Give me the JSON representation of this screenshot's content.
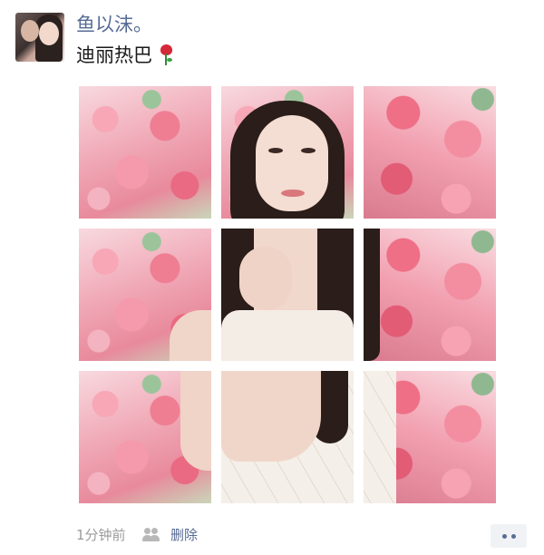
{
  "post": {
    "username": "鱼以沫。",
    "text": "迪丽热巴",
    "emoji": "rose-emoji",
    "image_count": 9
  },
  "footer": {
    "time": "1分钟前",
    "visibility_icon": "friends-icon",
    "delete_label": "删除",
    "more_icon": "more-dots-icon"
  },
  "colors": {
    "link": "#576b95",
    "meta": "#9b9b9b",
    "text": "#1a1a1a"
  }
}
